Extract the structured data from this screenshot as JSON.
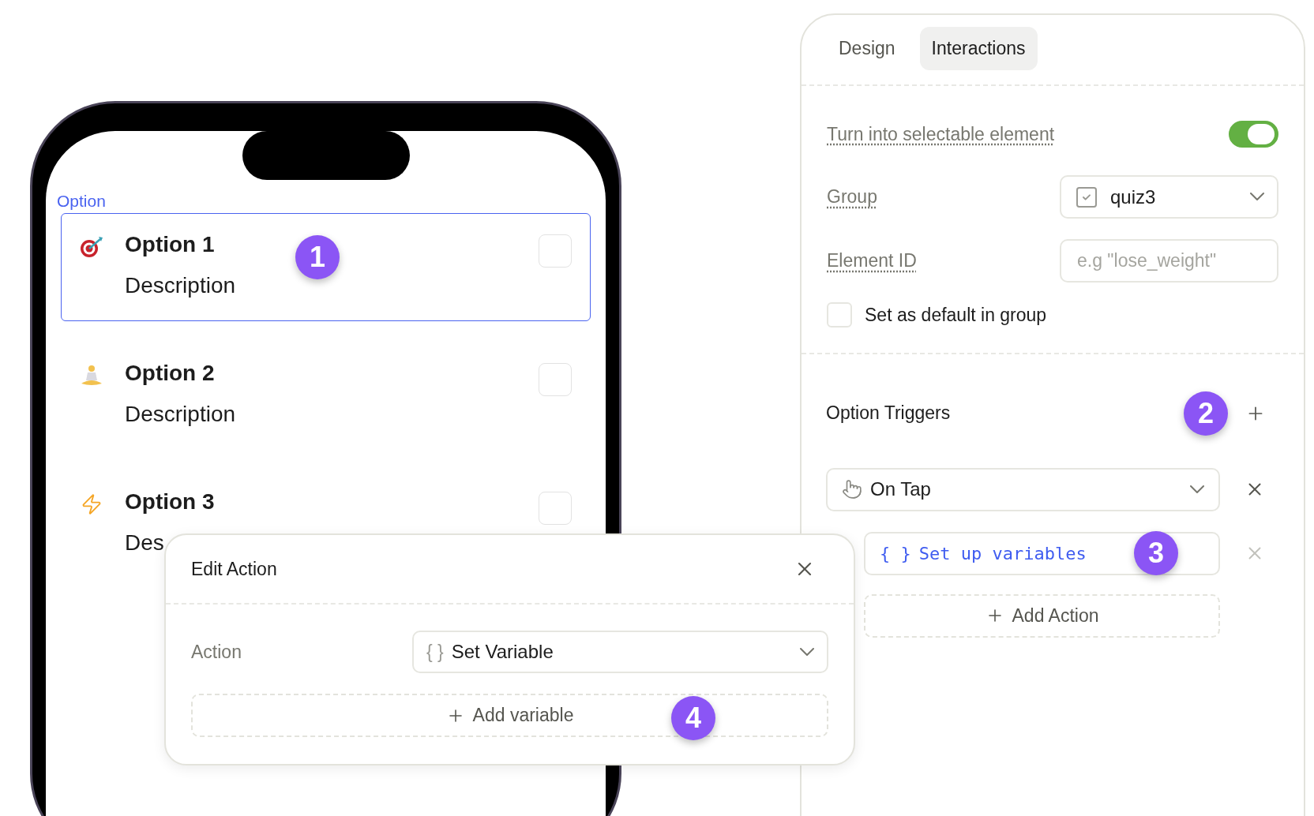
{
  "phone": {
    "section_label": "Option",
    "options": [
      {
        "title": "Option 1",
        "description": "Description",
        "selected": true,
        "checked": false,
        "badge": "1"
      },
      {
        "title": "Option 2",
        "description": "Description",
        "selected": false,
        "checked": false
      },
      {
        "title": "Option 3",
        "description": "Des",
        "selected": false,
        "checked": false
      }
    ]
  },
  "panel": {
    "tabs": [
      {
        "label": "Design",
        "selected": false
      },
      {
        "label": "Interactions",
        "selected": true
      }
    ],
    "selectable": {
      "label": "Turn into selectable element",
      "on": true
    },
    "group": {
      "label": "Group",
      "value": "quiz3"
    },
    "element_id": {
      "label": "Element ID",
      "placeholder": "e.g \"lose_weight\""
    },
    "default_in_group": {
      "label": "Set as default in group",
      "checked": false
    },
    "triggers": {
      "title": "Option Triggers",
      "badge": "2",
      "items": [
        {
          "trigger": "On Tap",
          "actions": [
            {
              "prefix": "{ }",
              "label": "Set up variables",
              "badge": "3"
            }
          ],
          "add_action": "Add Action"
        }
      ]
    }
  },
  "popup": {
    "title": "Edit Action",
    "action_label": "Action",
    "action_prefix": "{ }",
    "action_value": "Set Variable",
    "add_variable": "Add variable",
    "badge": "4"
  }
}
